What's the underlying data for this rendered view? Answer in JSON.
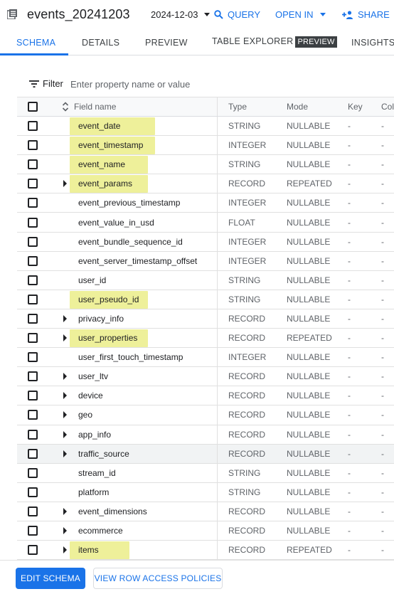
{
  "header": {
    "title": "events_20241203",
    "date": "2024-12-03",
    "query_label": "QUERY",
    "open_in_label": "OPEN IN",
    "share_label": "SHARE"
  },
  "tabs": [
    {
      "label": "SCHEMA",
      "active": true
    },
    {
      "label": "DETAILS"
    },
    {
      "label": "PREVIEW"
    },
    {
      "label": "TABLE EXPLORER",
      "badge": "PREVIEW"
    },
    {
      "label": "INSIGHTS"
    }
  ],
  "filter": {
    "label": "Filter",
    "placeholder": "Enter property name or value"
  },
  "table": {
    "columns": [
      "Field name",
      "Type",
      "Mode",
      "Key",
      "Col"
    ],
    "rows": [
      {
        "name": "event_date",
        "type": "STRING",
        "mode": "NULLABLE",
        "key": "-",
        "col": "-",
        "expandable": false,
        "highlight": true
      },
      {
        "name": "event_timestamp",
        "type": "INTEGER",
        "mode": "NULLABLE",
        "key": "-",
        "col": "-",
        "expandable": false,
        "highlight": true
      },
      {
        "name": "event_name",
        "type": "STRING",
        "mode": "NULLABLE",
        "key": "-",
        "col": "-",
        "expandable": false,
        "highlight": true
      },
      {
        "name": "event_params",
        "type": "RECORD",
        "mode": "REPEATED",
        "key": "-",
        "col": "-",
        "expandable": true,
        "highlight": true
      },
      {
        "name": "event_previous_timestamp",
        "type": "INTEGER",
        "mode": "NULLABLE",
        "key": "-",
        "col": "-",
        "expandable": false
      },
      {
        "name": "event_value_in_usd",
        "type": "FLOAT",
        "mode": "NULLABLE",
        "key": "-",
        "col": "-",
        "expandable": false
      },
      {
        "name": "event_bundle_sequence_id",
        "type": "INTEGER",
        "mode": "NULLABLE",
        "key": "-",
        "col": "-",
        "expandable": false
      },
      {
        "name": "event_server_timestamp_offset",
        "type": "INTEGER",
        "mode": "NULLABLE",
        "key": "-",
        "col": "-",
        "expandable": false
      },
      {
        "name": "user_id",
        "type": "STRING",
        "mode": "NULLABLE",
        "key": "-",
        "col": "-",
        "expandable": false
      },
      {
        "name": "user_pseudo_id",
        "type": "STRING",
        "mode": "NULLABLE",
        "key": "-",
        "col": "-",
        "expandable": false,
        "highlight": true
      },
      {
        "name": "privacy_info",
        "type": "RECORD",
        "mode": "NULLABLE",
        "key": "-",
        "col": "-",
        "expandable": true
      },
      {
        "name": "user_properties",
        "type": "RECORD",
        "mode": "REPEATED",
        "key": "-",
        "col": "-",
        "expandable": true,
        "highlight": true
      },
      {
        "name": "user_first_touch_timestamp",
        "type": "INTEGER",
        "mode": "NULLABLE",
        "key": "-",
        "col": "-",
        "expandable": false
      },
      {
        "name": "user_ltv",
        "type": "RECORD",
        "mode": "NULLABLE",
        "key": "-",
        "col": "-",
        "expandable": true
      },
      {
        "name": "device",
        "type": "RECORD",
        "mode": "NULLABLE",
        "key": "-",
        "col": "-",
        "expandable": true
      },
      {
        "name": "geo",
        "type": "RECORD",
        "mode": "NULLABLE",
        "key": "-",
        "col": "-",
        "expandable": true
      },
      {
        "name": "app_info",
        "type": "RECORD",
        "mode": "NULLABLE",
        "key": "-",
        "col": "-",
        "expandable": true
      },
      {
        "name": "traffic_source",
        "type": "RECORD",
        "mode": "NULLABLE",
        "key": "-",
        "col": "-",
        "expandable": true,
        "hover": true
      },
      {
        "name": "stream_id",
        "type": "STRING",
        "mode": "NULLABLE",
        "key": "-",
        "col": "-",
        "expandable": false
      },
      {
        "name": "platform",
        "type": "STRING",
        "mode": "NULLABLE",
        "key": "-",
        "col": "-",
        "expandable": false
      },
      {
        "name": "event_dimensions",
        "type": "RECORD",
        "mode": "NULLABLE",
        "key": "-",
        "col": "-",
        "expandable": true
      },
      {
        "name": "ecommerce",
        "type": "RECORD",
        "mode": "NULLABLE",
        "key": "-",
        "col": "-",
        "expandable": true
      },
      {
        "name": "items",
        "type": "RECORD",
        "mode": "REPEATED",
        "key": "-",
        "col": "-",
        "expandable": true,
        "highlight": true
      }
    ]
  },
  "footer": {
    "edit_schema_label": "EDIT SCHEMA",
    "row_access_label": "VIEW ROW ACCESS POLICIES"
  },
  "colors": {
    "accent": "#1a73e8",
    "highlight": "#eef09a",
    "text": "#202124",
    "muted": "#5f6368"
  }
}
